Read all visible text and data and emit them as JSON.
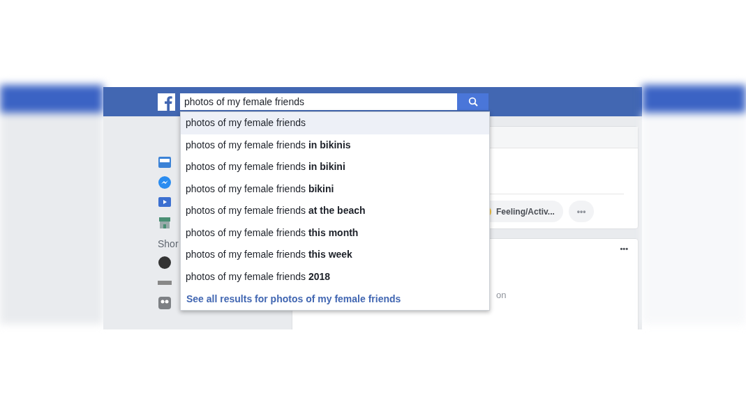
{
  "top_bar": {
    "search": {
      "value": "photos of my female friends"
    }
  },
  "search_suggestions": [
    {
      "text": "photos of my female friends",
      "selected": true
    },
    {
      "text": "photos of my female friends **in bikinis**",
      "selected": false
    },
    {
      "text": "photos of my female friends **in bikini**",
      "selected": false
    },
    {
      "text": "photos of my female friends **bikini**",
      "selected": false
    },
    {
      "text": "photos of my female friends **at the beach**",
      "selected": false
    },
    {
      "text": "photos of my female friends **this month**",
      "selected": false
    },
    {
      "text": "photos of my female friends **this week**",
      "selected": false
    },
    {
      "text": "photos of my female friends **2018**",
      "selected": false
    }
  ],
  "see_all_link": "See all results for photos of my female friends",
  "sidebar": {
    "items": [
      {
        "kind": "feed"
      },
      {
        "kind": "messenger"
      },
      {
        "kind": "watch"
      },
      {
        "kind": "shop"
      }
    ],
    "section_heading": "Shor",
    "shortcuts": [
      {
        "kind": "avatar"
      },
      {
        "kind": "logo"
      },
      {
        "kind": "group"
      }
    ]
  },
  "composer": {
    "buttons": [
      {
        "kind": "feeling",
        "label": "Feeling/Activ..."
      },
      {
        "kind": "more",
        "label": "•••"
      }
    ]
  },
  "post": {
    "text_fragments": [
      "on"
    ],
    "menu": "•••"
  }
}
